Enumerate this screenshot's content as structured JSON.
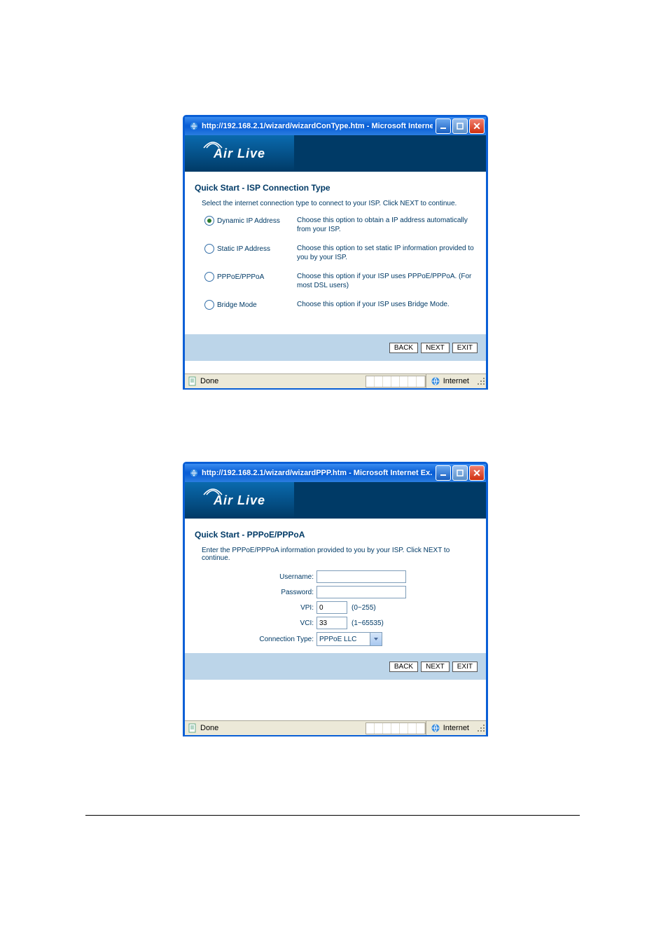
{
  "window1": {
    "title": "http://192.168.2.1/wizard/wizardConType.htm - Microsoft Interne...",
    "logo": "Air Live",
    "heading": "Quick Start - ISP Connection Type",
    "instruction": "Select the internet connection type to connect to your ISP. Click NEXT to continue.",
    "options": [
      {
        "label": "Dynamic IP Address",
        "checked": true,
        "desc": "Choose this option to obtain a IP address automatically from your ISP."
      },
      {
        "label": "Static IP Address",
        "checked": false,
        "desc": "Choose this option to set static IP information provided to you by your ISP."
      },
      {
        "label": "PPPoE/PPPoA",
        "checked": false,
        "desc": "Choose this option if your ISP uses PPPoE/PPPoA. (For most DSL users)"
      },
      {
        "label": "Bridge Mode",
        "checked": false,
        "desc": "Choose this option if your ISP uses Bridge Mode."
      }
    ],
    "buttons": {
      "back": "BACK",
      "next": "NEXT",
      "exit": "EXIT"
    },
    "status": {
      "left": "Done",
      "right": "Internet"
    }
  },
  "window2": {
    "title": "http://192.168.2.1/wizard/wizardPPP.htm - Microsoft Internet Ex...",
    "logo": "Air Live",
    "heading": "Quick Start - PPPoE/PPPoA",
    "instruction": "Enter the PPPoE/PPPoA information provided to you by your ISP. Click NEXT to continue.",
    "fields": {
      "username_label": "Username:",
      "username_value": "",
      "password_label": "Password:",
      "password_value": "",
      "vpi_label": "VPI:",
      "vpi_value": "0",
      "vpi_hint": "(0~255)",
      "vci_label": "VCI:",
      "vci_value": "33",
      "vci_hint": "(1~65535)",
      "conntype_label": "Connection Type:",
      "conntype_value": "PPPoE LLC"
    },
    "buttons": {
      "back": "BACK",
      "next": "NEXT",
      "exit": "EXIT"
    },
    "status": {
      "left": "Done",
      "right": "Internet"
    }
  }
}
